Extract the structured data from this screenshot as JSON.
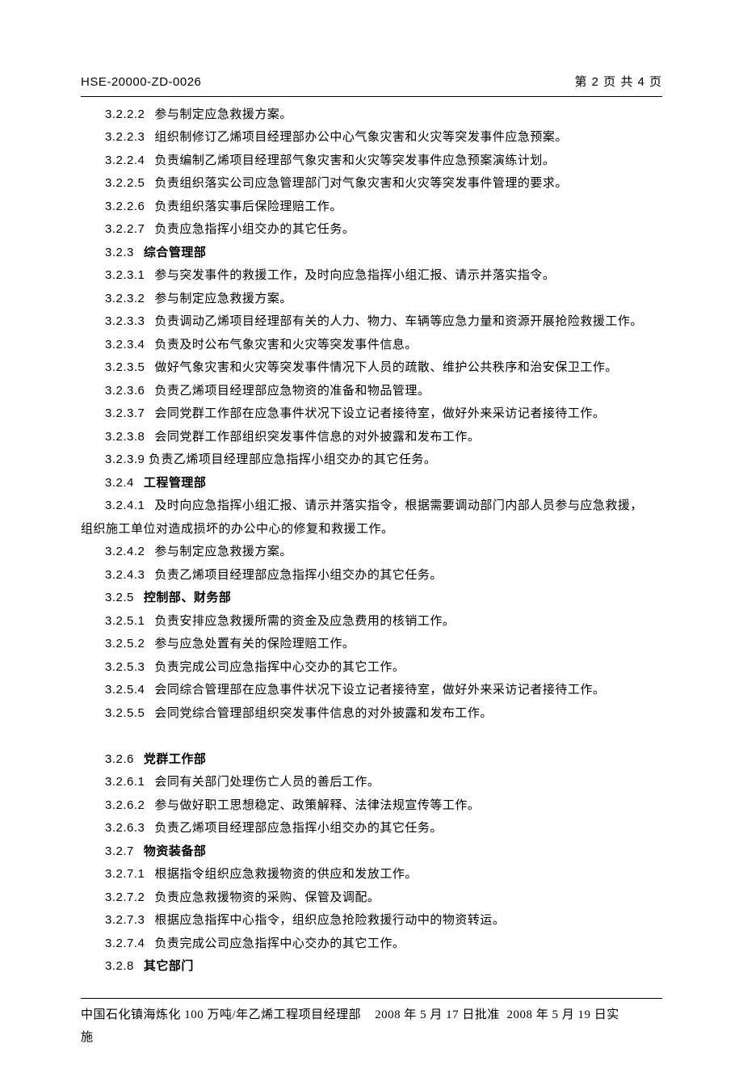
{
  "header": {
    "doc_id": "HSE-20000-ZD-0026",
    "page_info": "第 2 页  共 4 页"
  },
  "lines": [
    {
      "num": "3.2.2.2",
      "text": "参与制定应急救援方案。",
      "bold": false
    },
    {
      "num": "3.2.2.3",
      "text": "组织制修订乙烯项目经理部办公中心气象灾害和火灾等突发事件应急预案。",
      "bold": false
    },
    {
      "num": "3.2.2.4",
      "text": "负责编制乙烯项目经理部气象灾害和火灾等突发事件应急预案演练计划。",
      "bold": false
    },
    {
      "num": "3.2.2.5",
      "text": "负责组织落实公司应急管理部门对气象灾害和火灾等突发事件管理的要求。",
      "bold": false
    },
    {
      "num": "3.2.2.6",
      "text": "负责组织落实事后保险理赔工作。",
      "bold": false
    },
    {
      "num": "3.2.2.7",
      "text": "负责应急指挥小组交办的其它任务。",
      "bold": false
    },
    {
      "num": "3.2.3",
      "text": "综合管理部",
      "bold": true
    },
    {
      "num": "3.2.3.1",
      "text": "参与突发事件的救援工作，及时向应急指挥小组汇报、请示并落实指令。",
      "bold": false
    },
    {
      "num": "3.2.3.2",
      "text": "参与制定应急救援方案。",
      "bold": false
    },
    {
      "num": "3.2.3.3",
      "text": "负责调动乙烯项目经理部有关的人力、物力、车辆等应急力量和资源开展抢险救援工作。",
      "bold": false
    },
    {
      "num": "3.2.3.4",
      "text": "负责及时公布气象灾害和火灾等突发事件信息。",
      "bold": false
    },
    {
      "num": "3.2.3.5",
      "text": "做好气象灾害和火灾等突发事件情况下人员的疏散、维护公共秩序和治安保卫工作。",
      "bold": false
    },
    {
      "num": "3.2.3.6",
      "text": "负责乙烯项目经理部应急物资的准备和物品管理。",
      "bold": false
    },
    {
      "num": "3.2.3.7",
      "text": "会同党群工作部在应急事件状况下设立记者接待室，做好外来采访记者接待工作。",
      "bold": false
    },
    {
      "num": "3.2.3.8",
      "text": "会同党群工作部组织突发事件信息的对外披露和发布工作。",
      "bold": false
    },
    {
      "num": "3.2.3.9",
      "text": "负责乙烯项目经理部应急指挥小组交办的其它任务。",
      "bold": false,
      "narrow": true
    },
    {
      "num": "3.2.4",
      "text": "工程管理部",
      "bold": true
    },
    {
      "num": "3.2.4.1",
      "text": "及时向应急指挥小组汇报、请示并落实指令，根据需要调动部门内部人员参与应急救援，",
      "bold": false
    },
    {
      "cont": true,
      "text": "组织施工单位对造成损坏的办公中心的修复和救援工作。"
    },
    {
      "num": "3.2.4.2",
      "text": "参与制定应急救援方案。",
      "bold": false
    },
    {
      "num": "3.2.4.3",
      "text": "负责乙烯项目经理部应急指挥小组交办的其它任务。",
      "bold": false
    },
    {
      "num": "3.2.5",
      "text": "控制部、财务部",
      "bold": true
    },
    {
      "num": "3.2.5.1",
      "text": "负责安排应急救援所需的资金及应急费用的核销工作。",
      "bold": false
    },
    {
      "num": "3.2.5.2",
      "text": "参与应急处置有关的保险理赔工作。",
      "bold": false
    },
    {
      "num": "3.2.5.3",
      "text": "负责完成公司应急指挥中心交办的其它工作。",
      "bold": false
    },
    {
      "num": "3.2.5.4",
      "text": "会同综合管理部在应急事件状况下设立记者接待室，做好外来采访记者接待工作。",
      "bold": false
    },
    {
      "num": "3.2.5.5",
      "text": "会同党综合管理部组织突发事件信息的对外披露和发布工作。",
      "bold": false
    },
    {
      "blank": true
    },
    {
      "num": "3.2.6",
      "text": "党群工作部",
      "bold": true
    },
    {
      "num": "3.2.6.1",
      "text": "会同有关部门处理伤亡人员的善后工作。",
      "bold": false
    },
    {
      "num": "3.2.6.2",
      "text": "参与做好职工思想稳定、政策解释、法律法规宣传等工作。",
      "bold": false
    },
    {
      "num": "3.2.6.3",
      "text": "负责乙烯项目经理部应急指挥小组交办的其它任务。",
      "bold": false
    },
    {
      "num": "3.2.7",
      "text": "物资装备部",
      "bold": true
    },
    {
      "num": "3.2.7.1",
      "text": "根据指令组织应急救援物资的供应和发放工作。",
      "bold": false
    },
    {
      "num": "3.2.7.2",
      "text": "负责应急救援物资的采购、保管及调配。",
      "bold": false
    },
    {
      "num": "3.2.7.3",
      "text": "根据应急指挥中心指令，组织应急抢险救援行动中的物资转运。",
      "bold": false
    },
    {
      "num": "3.2.7.4",
      "text": "负责完成公司应急指挥中心交办的其它工作。",
      "bold": false
    },
    {
      "num": "3.2.8",
      "text": "其它部门",
      "bold": true
    }
  ],
  "footer": {
    "org": "中国石化镇海炼化 100 万吨/年乙烯工程项目经理部",
    "approve": "2008 年 5 月 17 日批准",
    "implement_part1": "2008 年 5 月 19 日实",
    "implement_part2": "施"
  }
}
